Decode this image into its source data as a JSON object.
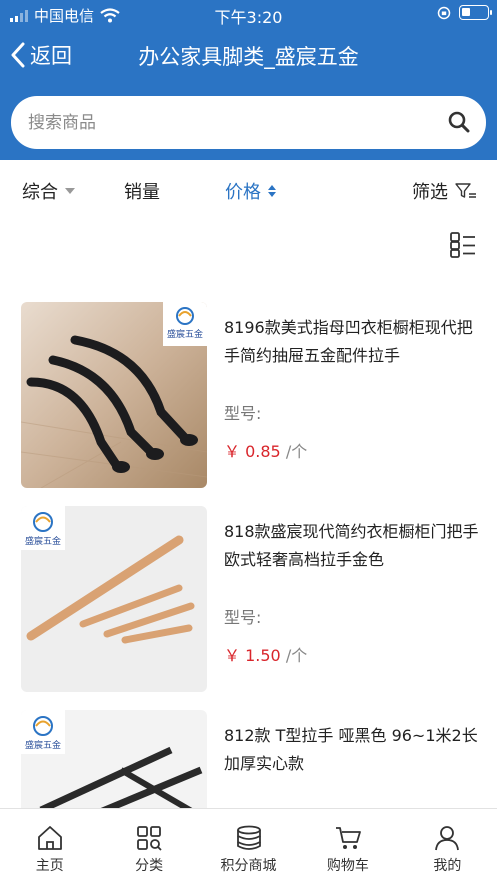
{
  "status_bar": {
    "carrier": "中国电信",
    "time": "下午3:20"
  },
  "nav": {
    "back_label": "返回",
    "title": "办公家具脚类_盛宸五金"
  },
  "search": {
    "placeholder": "搜索商品"
  },
  "sort_bar": {
    "items": [
      {
        "label": "综合",
        "active": false
      },
      {
        "label": "销量",
        "active": false
      },
      {
        "label": "价格",
        "active": true
      }
    ],
    "filter_label": "筛选"
  },
  "products": [
    {
      "name": "8196款美式指母凹衣柜橱柜现代把手简约抽屉五金配件拉手",
      "model_label": "型号:",
      "price_symbol": "￥",
      "price": "0.85",
      "unit": "/个",
      "image_logo": "盛宸五金"
    },
    {
      "name": "818款盛宸现代简约衣柜橱柜门把手欧式轻奢高档拉手金色",
      "model_label": "型号:",
      "price_symbol": "￥",
      "price": "1.50",
      "unit": "/个",
      "image_logo": "盛宸五金"
    },
    {
      "name": "812款 T型拉手 哑黑色 96~1米2长 加厚实心款",
      "model_label": "",
      "price_symbol": "",
      "price": "",
      "unit": "",
      "image_logo": "盛宸五金"
    }
  ],
  "tabs": [
    {
      "label": "主页",
      "icon": "home-icon"
    },
    {
      "label": "分类",
      "icon": "category-icon"
    },
    {
      "label": "积分商城",
      "icon": "coins-icon"
    },
    {
      "label": "购物车",
      "icon": "cart-icon"
    },
    {
      "label": "我的",
      "icon": "user-icon"
    }
  ],
  "colors": {
    "brand": "#2b74c4",
    "price": "#d9262c"
  }
}
